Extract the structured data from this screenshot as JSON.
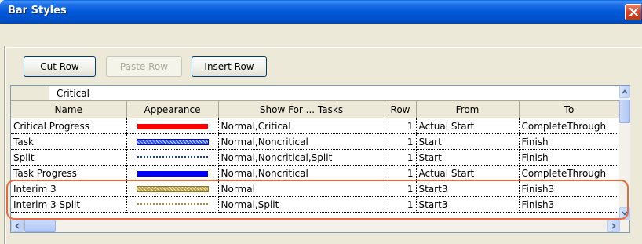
{
  "window": {
    "title": "Bar Styles"
  },
  "toolbar": {
    "cut_row": "Cut Row",
    "paste_row": "Paste Row",
    "insert_row": "Insert Row"
  },
  "entry": {
    "value": "Critical"
  },
  "columns": [
    "Name",
    "Appearance",
    "Show For ... Tasks",
    "Row",
    "From",
    "To"
  ],
  "rows": [
    {
      "name": "Critical Progress",
      "appearance": "solid-red-bar",
      "show_for": "Normal,Critical",
      "row": "1",
      "from": "Actual Start",
      "to": "CompleteThrough"
    },
    {
      "name": "Task",
      "appearance": "hatched-blue-bar",
      "show_for": "Normal,Noncritical",
      "row": "1",
      "from": "Start",
      "to": "Finish"
    },
    {
      "name": "Split",
      "appearance": "dotted-blue-line",
      "show_for": "Normal,Noncritical,Split",
      "row": "1",
      "from": "Start",
      "to": "Finish"
    },
    {
      "name": "Task Progress",
      "appearance": "solid-blue-bar",
      "show_for": "Normal,Noncritical",
      "row": "1",
      "from": "Actual Start",
      "to": "CompleteThrough"
    },
    {
      "name": "Interim 3",
      "appearance": "hatched-olive-bar",
      "show_for": "Normal",
      "row": "1",
      "from": "Start3",
      "to": "Finish3"
    },
    {
      "name": "Interim 3 Split",
      "appearance": "dotted-olive-line",
      "show_for": "Normal,Split",
      "row": "1",
      "from": "Start3",
      "to": "Finish3"
    }
  ],
  "colors": {
    "titlebar": "#0058D8",
    "highlight": "#E96A3A",
    "critical_bar": "#FF0000",
    "task_bar": "#0000FF",
    "interim_bar": "#B9A24A"
  }
}
